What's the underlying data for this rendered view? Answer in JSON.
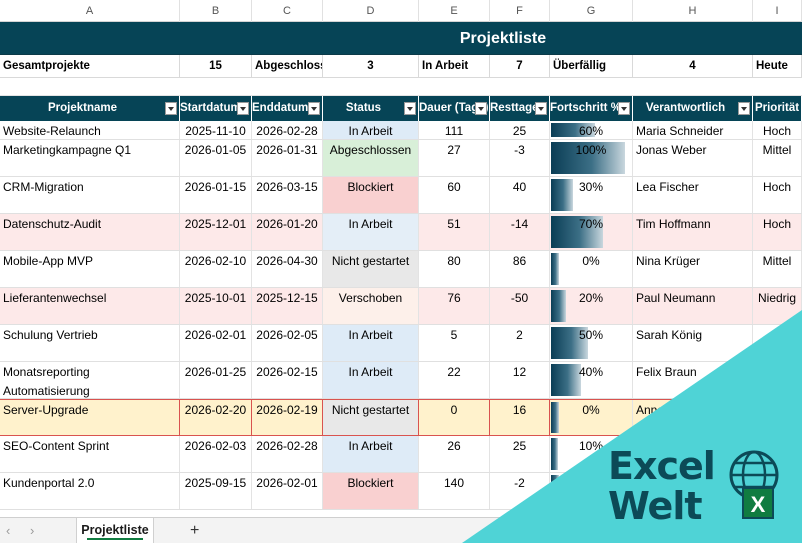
{
  "columns": [
    "A",
    "B",
    "C",
    "D",
    "E",
    "F",
    "G",
    "H",
    "I"
  ],
  "title": "Projektliste",
  "summary": {
    "total_label": "Gesamtprojekte",
    "total_value": "15",
    "done_label": "Abgeschlosse",
    "done_value": "3",
    "inwork_label": "In Arbeit",
    "inwork_value": "7",
    "overdue_label": "Überfällig",
    "overdue_value": "4",
    "today_label": "Heute"
  },
  "headers": [
    "Projektname",
    "Startdatum",
    "Enddatum",
    "Status",
    "Dauer (Tage)",
    "Resttage",
    "Fortschritt %",
    "Verantwortlich",
    "Priorität"
  ],
  "rows": [
    {
      "name": "Website-Relaunch",
      "start": "2025-11-10",
      "end": "2026-02-28",
      "status": "In Arbeit",
      "dauer": "111",
      "rest": "25",
      "progress": 0.6,
      "progress_label": "60%",
      "owner": "Maria Schneider",
      "prio": "Hoch"
    },
    {
      "name": "Marketingkampagne Q1",
      "start": "2026-01-05",
      "end": "2026-01-31",
      "status": "Abgeschlossen",
      "dauer": "27",
      "rest": "-3",
      "progress": 1.0,
      "progress_label": "100%",
      "owner": "Jonas Weber",
      "prio": "Mittel"
    },
    {
      "name": "CRM-Migration",
      "start": "2026-01-15",
      "end": "2026-03-15",
      "status": "Blockiert",
      "dauer": "60",
      "rest": "40",
      "progress": 0.3,
      "progress_label": "30%",
      "owner": "Lea Fischer",
      "prio": "Hoch"
    },
    {
      "name": "Datenschutz-Audit",
      "start": "2025-12-01",
      "end": "2026-01-20",
      "status": "In Arbeit",
      "dauer": "51",
      "rest": "-14",
      "progress": 0.7,
      "progress_label": "70%",
      "owner": "Tim Hoffmann",
      "prio": "Hoch"
    },
    {
      "name": "Mobile-App MVP",
      "start": "2026-02-10",
      "end": "2026-04-30",
      "status": "Nicht gestartet",
      "dauer": "80",
      "rest": "86",
      "progress": 0.0,
      "progress_label": "0%",
      "owner": "Nina Krüger",
      "prio": "Mittel"
    },
    {
      "name": "Lieferantenwechsel",
      "start": "2025-10-01",
      "end": "2025-12-15",
      "status": "Verschoben",
      "dauer": "76",
      "rest": "-50",
      "progress": 0.2,
      "progress_label": "20%",
      "owner": "Paul Neumann",
      "prio": "Niedrig"
    },
    {
      "name": "Schulung Vertrieb",
      "start": "2026-02-01",
      "end": "2026-02-05",
      "status": "In Arbeit",
      "dauer": "5",
      "rest": "2",
      "progress": 0.5,
      "progress_label": "50%",
      "owner": "Sarah König",
      "prio": ""
    },
    {
      "name": "Monatsreporting Automatisierung",
      "start": "2026-01-25",
      "end": "2026-02-15",
      "status": "In Arbeit",
      "dauer": "22",
      "rest": "12",
      "progress": 0.4,
      "progress_label": "40%",
      "owner": "Felix Braun",
      "prio": ""
    },
    {
      "name": "Server-Upgrade",
      "start": "2026-02-20",
      "end": "2026-02-19",
      "status": "Nicht gestartet",
      "dauer": "0",
      "rest": "16",
      "progress": 0.0,
      "progress_label": "0%",
      "owner": "Anna",
      "prio": ""
    },
    {
      "name": "SEO-Content Sprint",
      "start": "2026-02-03",
      "end": "2026-02-28",
      "status": "In Arbeit",
      "dauer": "26",
      "rest": "25",
      "progress": 0.1,
      "progress_label": "10%",
      "owner": "",
      "prio": ""
    },
    {
      "name": "Kundenportal 2.0",
      "start": "2025-09-15",
      "end": "2026-02-01",
      "status": "Blockiert",
      "dauer": "140",
      "rest": "-2",
      "progress": 0.0,
      "progress_label": "",
      "owner": "",
      "prio": ""
    }
  ],
  "sheet_tab": "Projektliste",
  "add_sheet": "+",
  "nav_prev": "‹",
  "nav_next": "›",
  "logo": {
    "line1": "Excel",
    "line2": "Welt",
    "x_mark": "X"
  },
  "colors": {
    "header_bg": "#064456",
    "accent_green": "#107c41",
    "logo_teal": "#4fd3d6"
  }
}
